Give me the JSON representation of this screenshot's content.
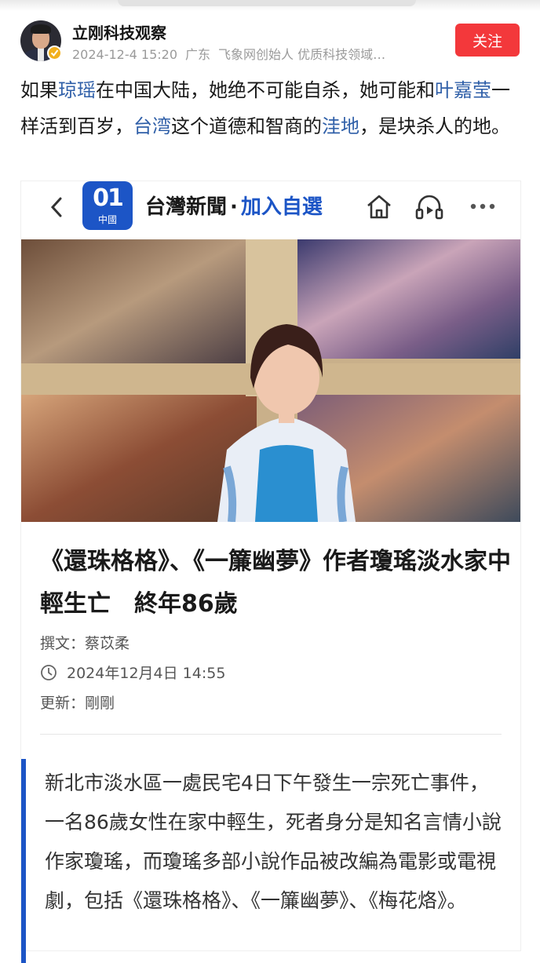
{
  "post": {
    "author": "立刚科技观察",
    "date": "2024-12-4 15:20",
    "location": "广东",
    "bio": "飞象网创始人 优质科技领域…",
    "follow_label": "关注",
    "text": [
      {
        "t": "如果",
        "link": false
      },
      {
        "t": "琼瑶",
        "link": true
      },
      {
        "t": "在中国大陆，她绝不可能自杀，她可能和",
        "link": false
      },
      {
        "t": "叶嘉莹",
        "link": true
      },
      {
        "t": "一样活到百岁，",
        "link": false
      },
      {
        "t": "台湾",
        "link": true
      },
      {
        "t": "这个道德和智商的",
        "link": false
      },
      {
        "t": "洼地",
        "link": true
      },
      {
        "t": "，是块杀人的地。",
        "link": false
      }
    ]
  },
  "article": {
    "logo_big": "01",
    "logo_small": "中國",
    "nav_title": "台灣新聞",
    "nav_dot": "·",
    "nav_add": "加入自選",
    "headline": "《還珠格格》、《一簾幽夢》作者瓊瑤淡水家中輕生亡　終年86歲",
    "byline": "撰文：蔡苡柔",
    "datetime": "2024年12月4日 14:55",
    "updated": "更新：剛剛",
    "body": "新北市淡水區一處民宅4日下午發生一宗死亡事件，一名86歲女性在家中輕生，死者身分是知名言情小說作家瓊瑤，而瓊瑤多部小說作品被改編為電影或電視劇，包括《還珠格格》、《一簾幽夢》、《梅花烙》。"
  },
  "colors": {
    "follow": "#f3383b",
    "link": "#2f5fa8",
    "brand": "#1c55c6"
  }
}
